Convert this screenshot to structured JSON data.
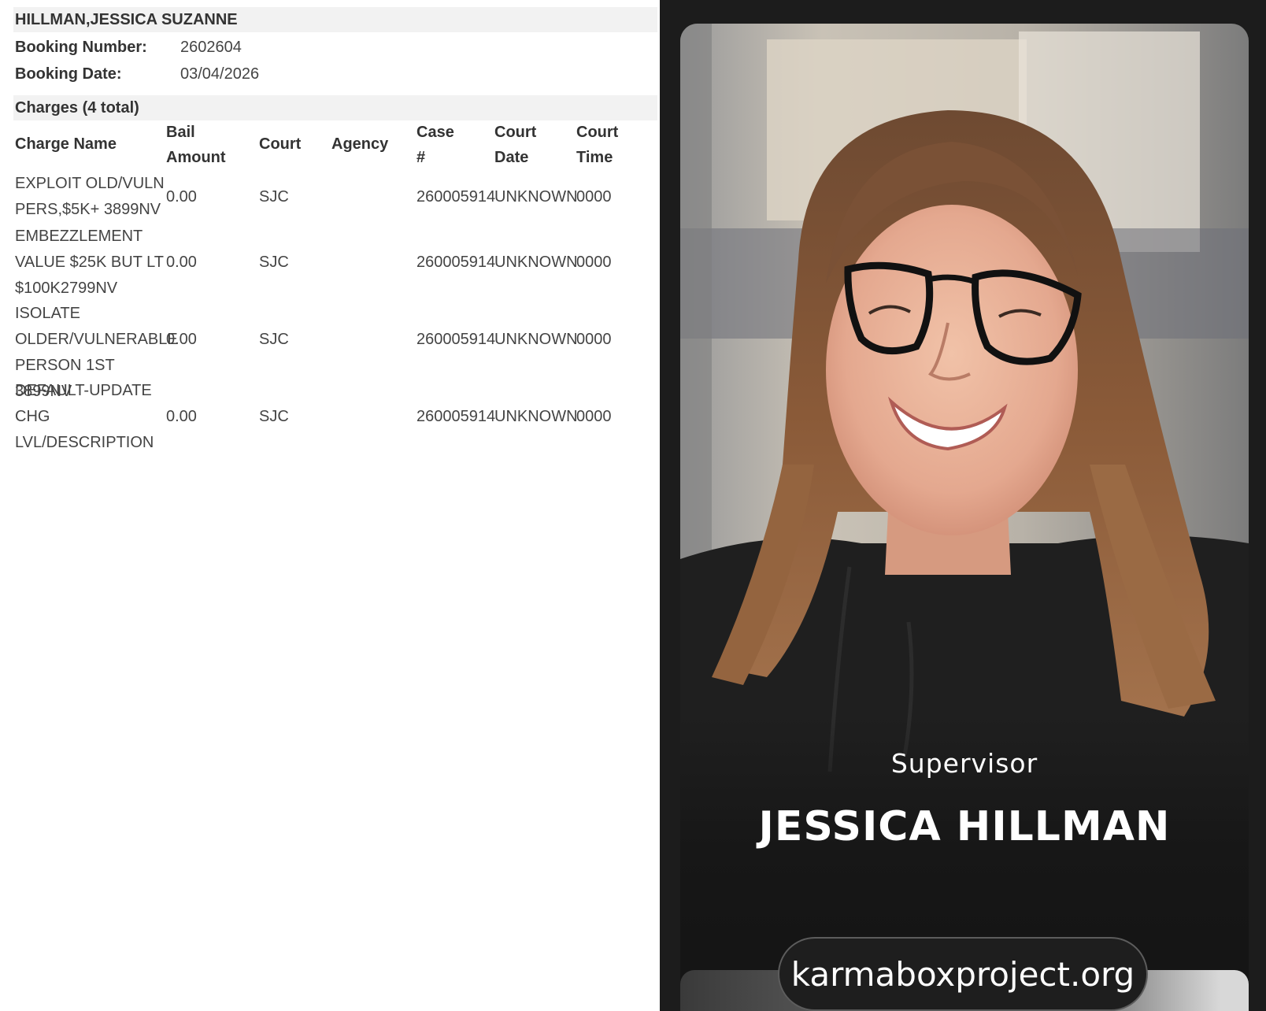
{
  "record": {
    "name": "HILLMAN,JESSICA SUZANNE",
    "booking_number_label": "Booking Number:",
    "booking_number": "2602604",
    "booking_date_label": "Booking Date:",
    "booking_date": "03/04/2026",
    "charges_heading": "Charges (4 total)",
    "columns": {
      "charge_name": "Charge Name",
      "bail_amount_1": "Bail",
      "bail_amount_2": "Amount",
      "court": "Court",
      "agency": "Agency",
      "case_1": "Case",
      "case_2": "#",
      "court_date_1": "Court",
      "court_date_2": "Date",
      "court_time_1": "Court",
      "court_time_2": "Time"
    },
    "charges": [
      {
        "name_lines": [
          "EXPLOIT OLD/VULN",
          "PERS,$5K+ 3899NV"
        ],
        "bail": "0.00",
        "court": "SJC",
        "agency": "",
        "case": "260005914",
        "court_date": "UNKNOWN",
        "court_time": "0000"
      },
      {
        "name_lines": [
          "EMBEZZLEMENT",
          "VALUE $25K BUT LT",
          "$100K2799NV"
        ],
        "bail": "0.00",
        "court": "SJC",
        "agency": "",
        "case": "260005914",
        "court_date": "UNKNOWN",
        "court_time": "0000"
      },
      {
        "name_lines": [
          "ISOLATE",
          "OLDER/VULNERABLE",
          "PERSON 1ST 3899NV"
        ],
        "bail": "0.00",
        "court": "SJC",
        "agency": "",
        "case": "260005914",
        "court_date": "UNKNOWN",
        "court_time": "0000"
      },
      {
        "name_lines": [
          "DEFAULT-UPDATE",
          "CHG",
          "LVL/DESCRIPTION"
        ],
        "bail": "0.00",
        "court": "SJC",
        "agency": "",
        "case": "260005914",
        "court_date": "UNKNOWN",
        "court_time": "0000"
      }
    ]
  },
  "profile": {
    "role": "Supervisor",
    "name": "JESSICA HILLMAN",
    "website": "karmaboxproject.org"
  },
  "colors": {
    "band": "#f2f2f2",
    "panel_bg": "#1c1c1c",
    "hair": "#8a5a38",
    "sweatshirt": "#1f1f1f"
  }
}
